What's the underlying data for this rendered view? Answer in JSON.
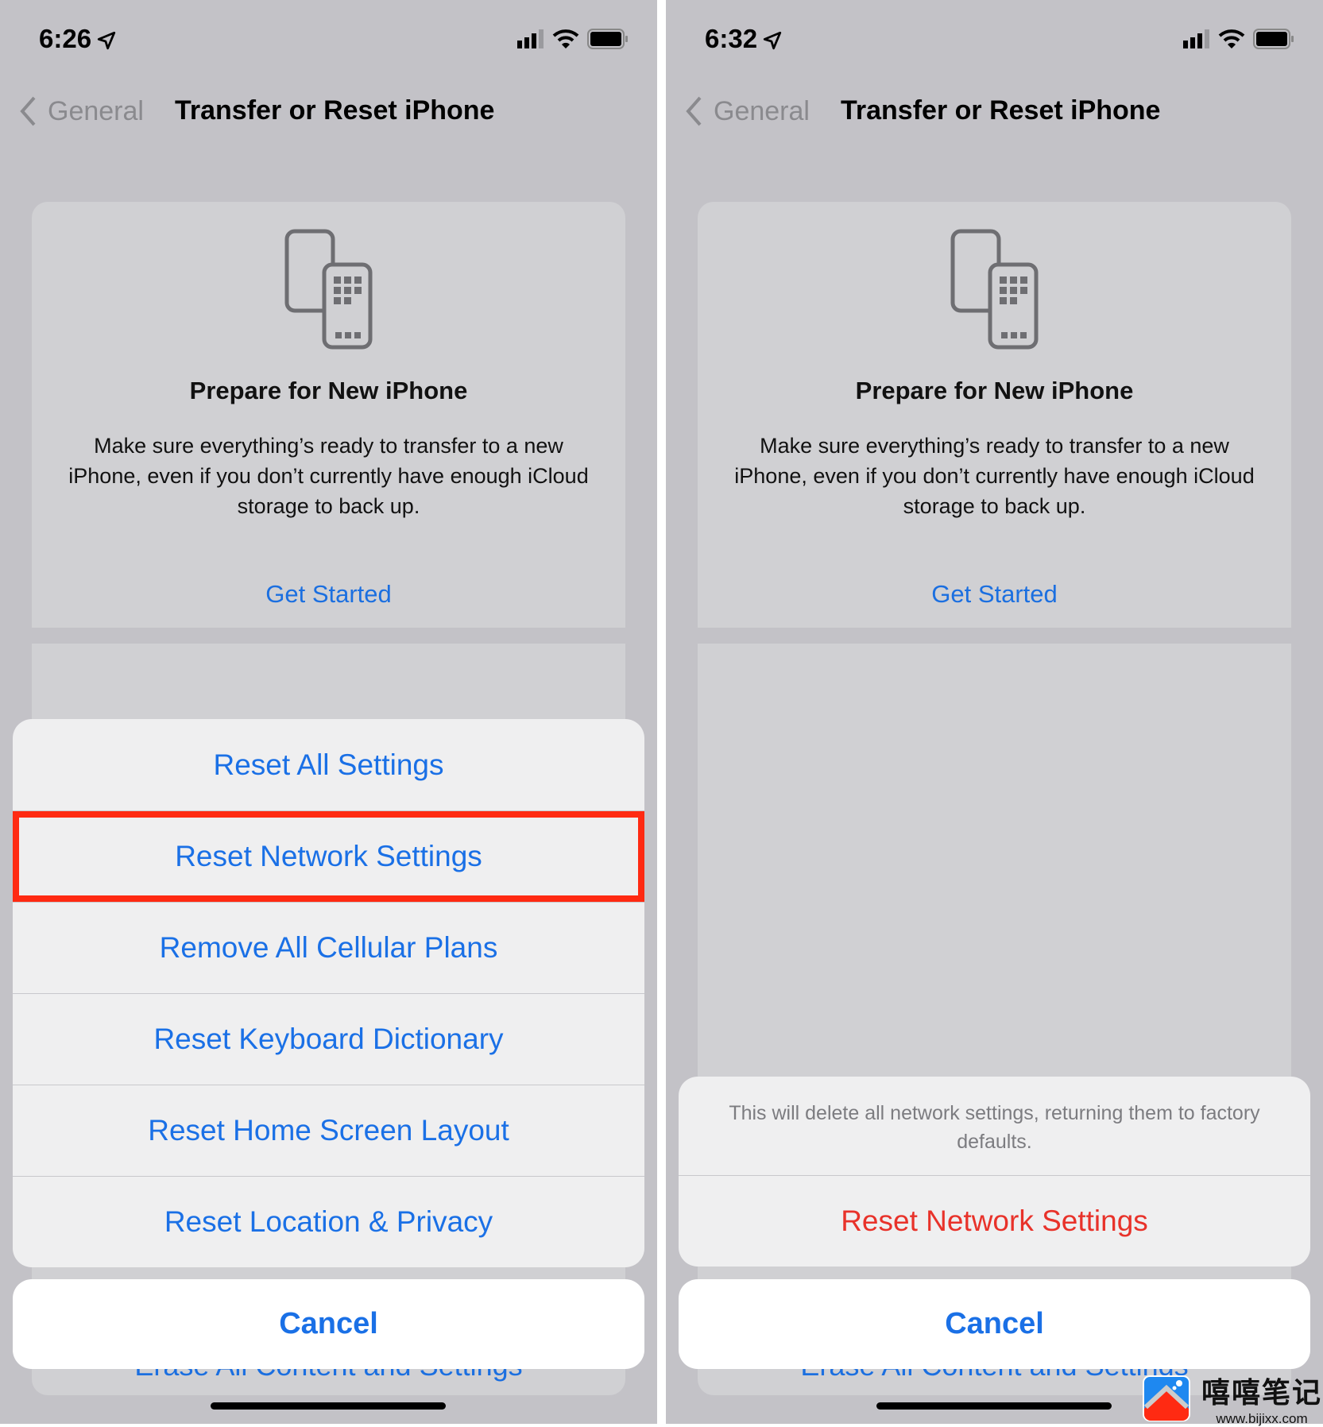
{
  "colors": {
    "accent": "#1a70e6",
    "destructive": "#e8322a",
    "highlight": "#ff2a12"
  },
  "left": {
    "status": {
      "time": "6:26"
    },
    "nav": {
      "back": "General",
      "title": "Transfer or Reset iPhone"
    },
    "card": {
      "title": "Prepare for New iPhone",
      "body": "Make sure everything’s ready to transfer to a new iPhone, even if you don’t currently have enough iCloud storage to back up.",
      "action": "Get Started",
      "hidden_item": "Erase All Content and Settings"
    },
    "sheet": {
      "items": [
        {
          "label": "Reset All Settings"
        },
        {
          "label": "Reset Network Settings",
          "highlighted": true
        },
        {
          "label": "Remove All Cellular Plans"
        },
        {
          "label": "Reset Keyboard Dictionary"
        },
        {
          "label": "Reset Home Screen Layout"
        },
        {
          "label": "Reset Location & Privacy"
        }
      ],
      "cancel": "Cancel"
    }
  },
  "right": {
    "status": {
      "time": "6:32"
    },
    "nav": {
      "back": "General",
      "title": "Transfer or Reset iPhone"
    },
    "card": {
      "title": "Prepare for New iPhone",
      "body": "Make sure everything’s ready to transfer to a new iPhone, even if you don’t currently have enough iCloud storage to back up.",
      "action": "Get Started",
      "hidden_item": "Erase All Content and Settings"
    },
    "sheet": {
      "message": "This will delete all network settings, returning them to factory defaults.",
      "confirm": "Reset Network Settings",
      "cancel": "Cancel"
    }
  },
  "watermark": {
    "name": "嘻嘻笔记",
    "url": "www.bijixx.com"
  }
}
